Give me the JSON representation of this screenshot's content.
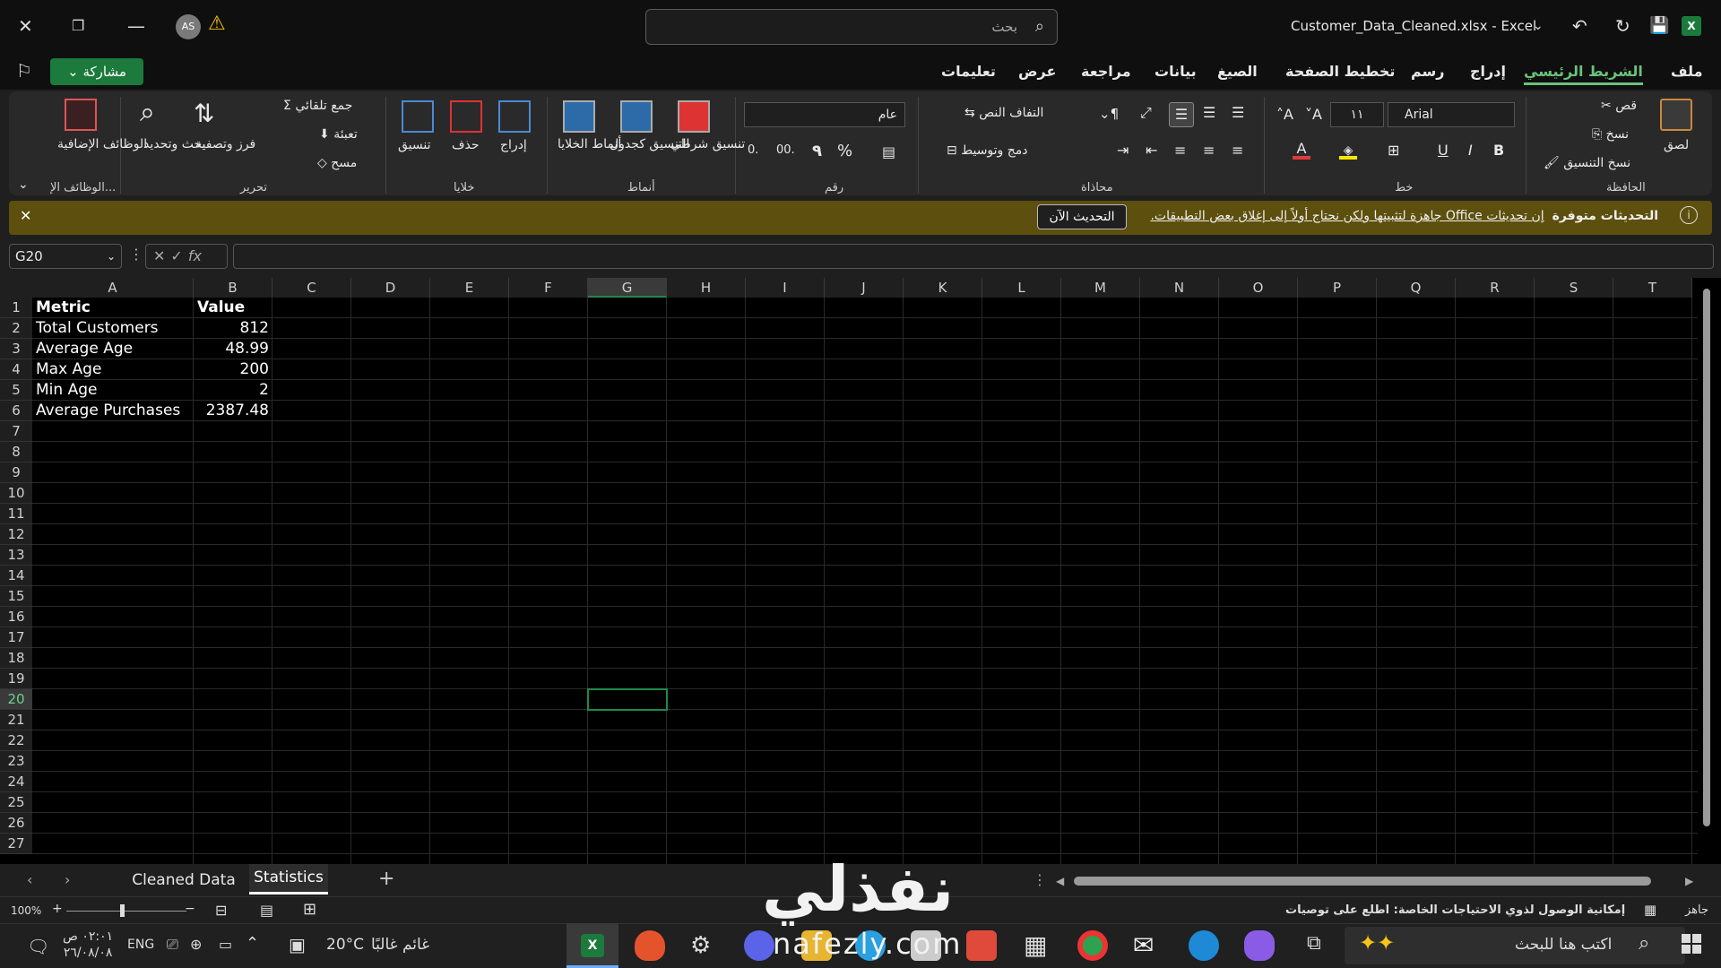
{
  "titlebar": {
    "search_placeholder": "بحث",
    "avatar_initials": "AS",
    "doc_title": "Customer_Data_Cleaned.xlsx  -  Excel"
  },
  "menu": {
    "share": "مشاركة",
    "tabs": [
      "ملف",
      "الشريط الرئيسي",
      "إدراج",
      "رسم",
      "تخطيط الصفحة",
      "الصيغ",
      "بيانات",
      "مراجعة",
      "عرض",
      "تعليمات"
    ]
  },
  "ribbon": {
    "clipboard": {
      "label": "الحافظة",
      "paste": "لصق",
      "cut": "قص",
      "copy": "نسخ",
      "format_painter": "نسخ التنسيق"
    },
    "font": {
      "label": "خط",
      "name": "Arial",
      "size": "١١"
    },
    "alignment": {
      "label": "محاذاة",
      "wrap": "التفاف النص",
      "merge": "دمج وتوسيط"
    },
    "number": {
      "label": "رقم",
      "format": "عام"
    },
    "styles": {
      "label": "أنماط",
      "conditional": "تنسيق شرطي",
      "format_table": "التنسيق كجدول",
      "cell_styles": "أنماط الخلايا"
    },
    "cells": {
      "label": "خلايا",
      "insert": "إدراج",
      "delete": "حذف",
      "format": "تنسيق"
    },
    "editing": {
      "label": "تحرير",
      "autosum": "جمع تلقائي",
      "fill": "تعبئة",
      "clear": "مسح",
      "sort": "فرز وتصفية",
      "find": "بحث وتحديد"
    },
    "addins": {
      "label": "الوظائف الإ...",
      "button": "الوظائف الإضافية"
    }
  },
  "notification": {
    "title": "التحديثات متوفرة",
    "message": "إن تحديثات Office جاهزة لتثبيتها ولكن نحتاج أولاً إلى إغلاق بعض التطبيقات.",
    "button": "التحديث الآن"
  },
  "formula": {
    "name_box": "G20",
    "fx": "fx",
    "value": ""
  },
  "columns": [
    "A",
    "B",
    "C",
    "D",
    "E",
    "F",
    "G",
    "H",
    "I",
    "J",
    "K",
    "L",
    "M",
    "N",
    "O",
    "P",
    "Q",
    "R",
    "S",
    "T"
  ],
  "rows": [
    "1",
    "2",
    "3",
    "4",
    "5",
    "6",
    "7",
    "8",
    "9",
    "10",
    "11",
    "12",
    "13",
    "14",
    "15",
    "16",
    "17",
    "18",
    "19",
    "20",
    "21",
    "22",
    "23",
    "24",
    "25",
    "26",
    "27"
  ],
  "cells": {
    "A1": "Metric",
    "B1": "Value",
    "A2": "Total Customers",
    "B2": "812",
    "A3": "Average Age",
    "B3": "48.99",
    "A4": "Max Age",
    "B4": "200",
    "A5": "Min Age",
    "B5": "2",
    "A6": "Average Purchases",
    "B6": "2387.48"
  },
  "sheets": {
    "tab1": "Cleaned Data",
    "tab2": "Statistics",
    "add": "+"
  },
  "status": {
    "zoom": "100%",
    "ready": "جاهز",
    "accessibility": "إمكانية الوصول لذوي الاحتياجات الخاصة: اطلع على توصيات"
  },
  "taskbar": {
    "search": "اكتب هنا للبحث",
    "weather": "غائم غالبًا",
    "temp": "20°C",
    "lang": "ENG",
    "time": "٠٢:٠١ ص",
    "date": "٢٦/٠٨/٠٨"
  },
  "watermark": {
    "text": "نفذلي",
    "sub": "nafezly.com"
  }
}
